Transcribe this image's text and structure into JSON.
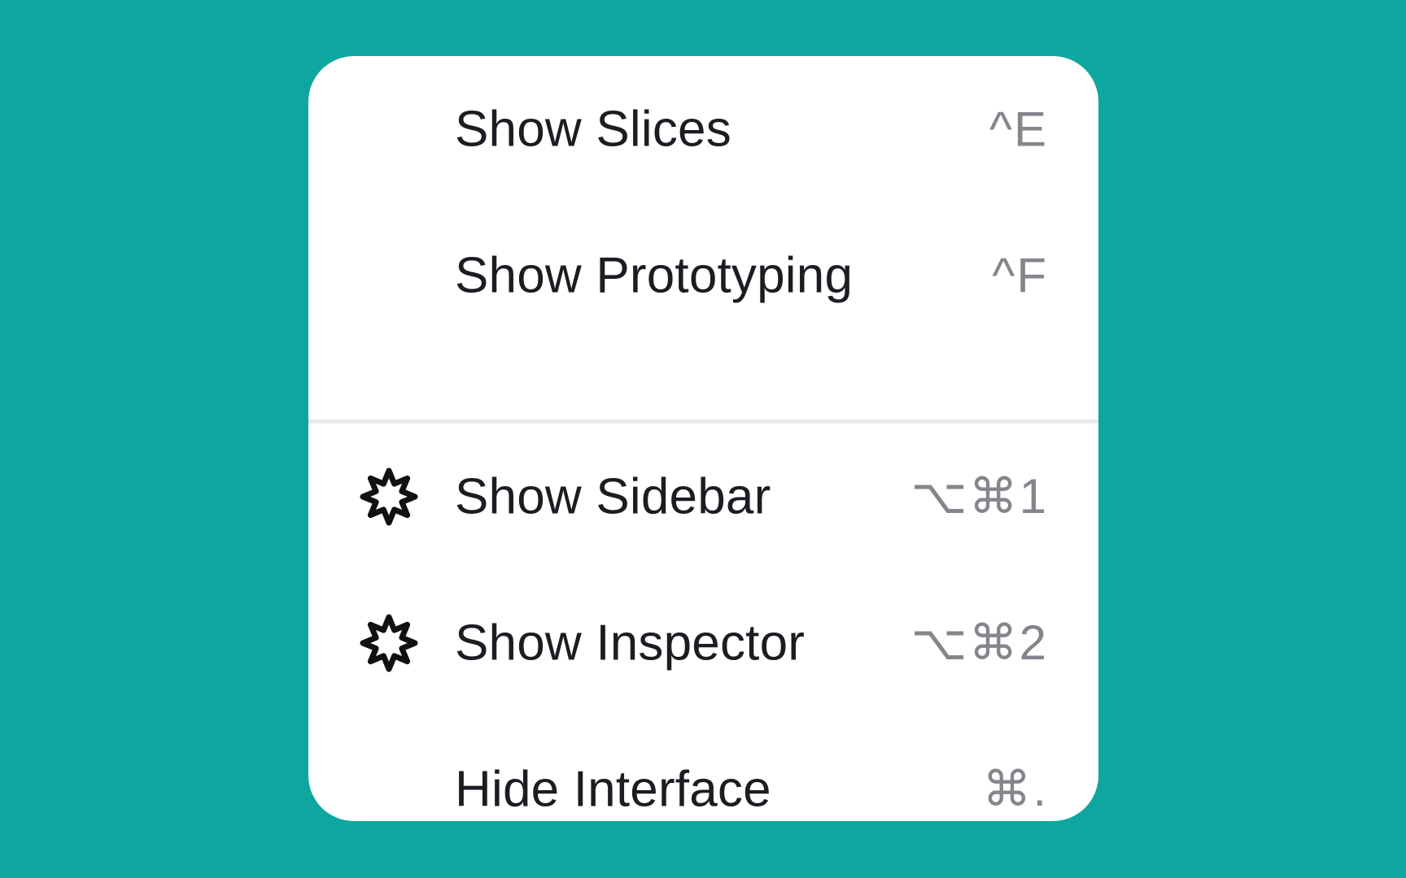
{
  "colors": {
    "background": "#10a6a0",
    "menu_background": "#ffffff",
    "label_text": "#1c1c22",
    "shortcut_text": "#85858c",
    "divider": "#eaeaec"
  },
  "menu": {
    "top_group": [
      {
        "label": "Show Slices",
        "shortcut": "^E",
        "icon": ""
      },
      {
        "label": "Show Prototyping",
        "shortcut": "^F",
        "icon": ""
      }
    ],
    "bottom_group": [
      {
        "label": "Show Sidebar",
        "shortcut": "⌥⌘1",
        "icon": "starburst-icon"
      },
      {
        "label": "Show Inspector",
        "shortcut": "⌥⌘2",
        "icon": "starburst-icon"
      },
      {
        "label": "Hide Interface",
        "shortcut": "⌘.",
        "icon": ""
      }
    ]
  }
}
